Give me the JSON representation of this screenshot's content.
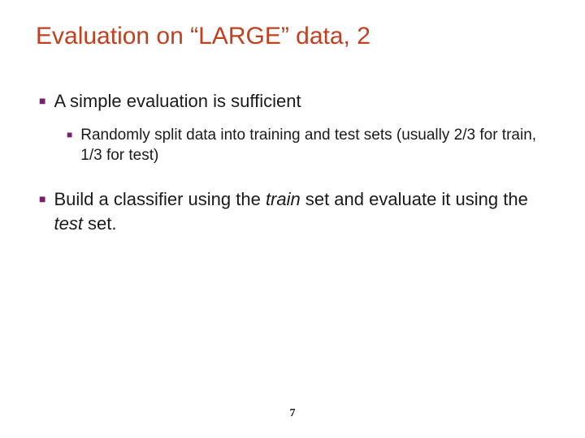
{
  "slide": {
    "title": "Evaluation on “LARGE” data, 2",
    "bullets": [
      {
        "level": 1,
        "text": "A simple evaluation is sufficient"
      },
      {
        "level": 2,
        "text": "Randomly split data into training and test sets (usually 2/3 for train, 1/3 for test)"
      },
      {
        "level": 1,
        "text_pre": "Build a classifier using the ",
        "italic1": "train",
        "text_mid": " set and evaluate it using the ",
        "italic2": "test",
        "text_post": " set."
      }
    ],
    "page_number": "7"
  }
}
